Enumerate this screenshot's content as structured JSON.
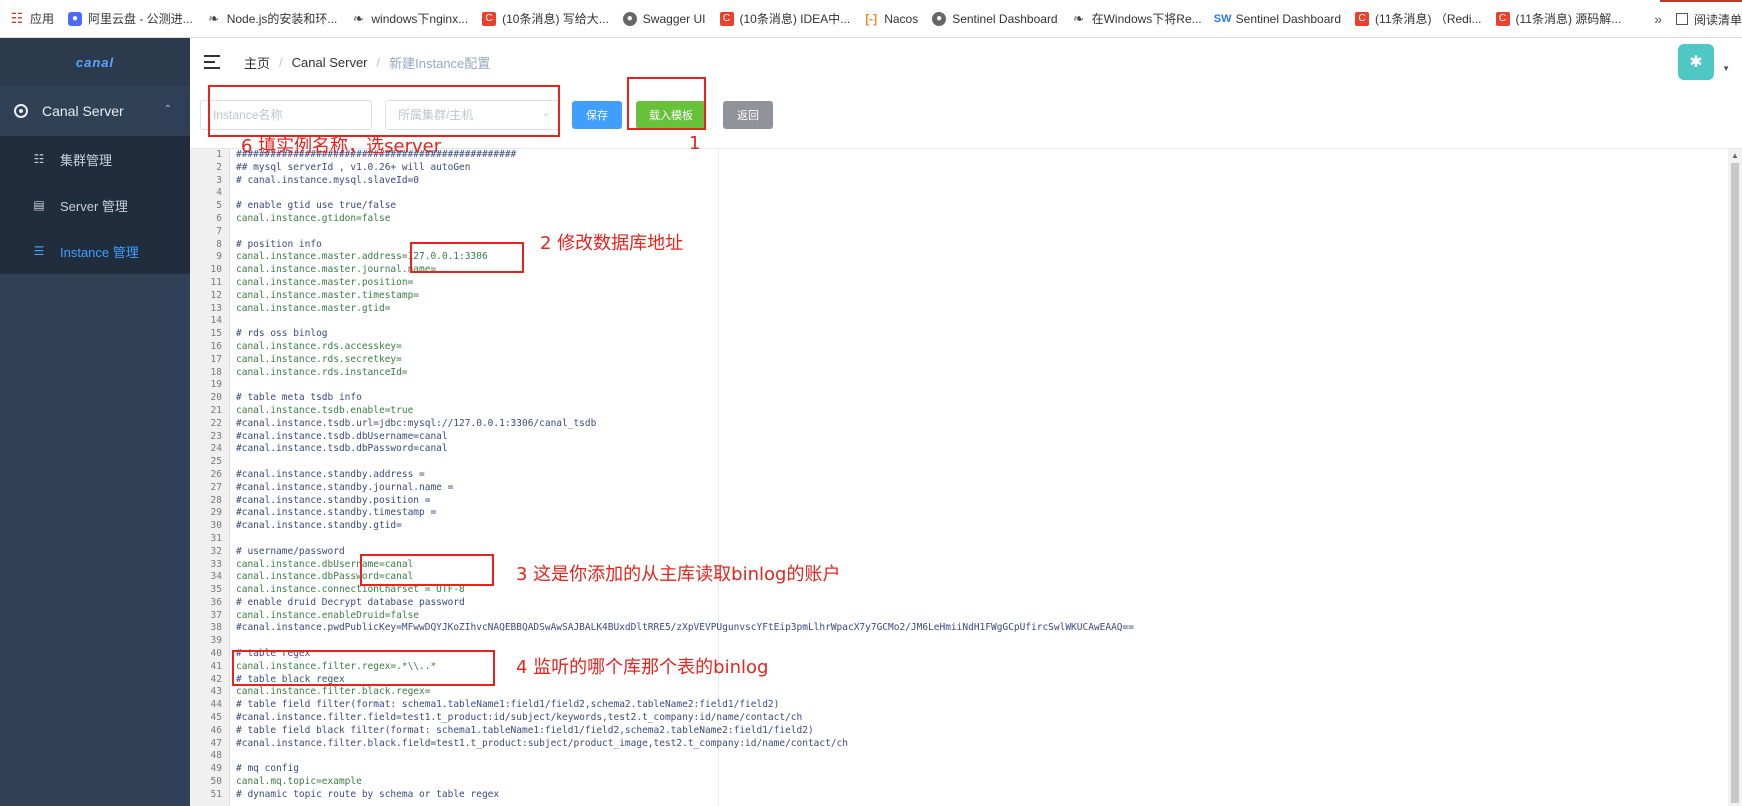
{
  "bookmarks": {
    "items": [
      {
        "icon": "apps-grid-icon",
        "label": "应用"
      },
      {
        "icon": "aliyun-icon",
        "label": "阿里云盘 - 公测进..."
      },
      {
        "icon": "yuque-icon",
        "label": "Node.js的安装和环..."
      },
      {
        "icon": "yuque-icon",
        "label": "windows下nginx..."
      },
      {
        "icon": "csdn-icon",
        "label": "(10条消息) 写给大..."
      },
      {
        "icon": "globe-icon",
        "label": "Swagger UI"
      },
      {
        "icon": "csdn-icon",
        "label": "(10条消息) IDEA中..."
      },
      {
        "icon": "nacos-icon",
        "label": "Nacos"
      },
      {
        "icon": "globe-icon",
        "label": "Sentinel Dashboard"
      },
      {
        "icon": "yuque-icon",
        "label": "在Windows下将Re..."
      },
      {
        "icon": "sw-icon",
        "label": "Sentinel Dashboard"
      },
      {
        "icon": "csdn-icon",
        "label": "(11条消息) （Redi..."
      },
      {
        "icon": "csdn-icon",
        "label": "(11条消息) 源码解..."
      }
    ],
    "more": "»",
    "reader": "阅读清单"
  },
  "sidebar": {
    "logo": "canal",
    "group_label": "Canal Server",
    "items": [
      {
        "label": "集群管理",
        "icon": "cluster-icon"
      },
      {
        "label": "Server 管理",
        "icon": "server-icon"
      },
      {
        "label": "Instance 管理",
        "icon": "list-icon"
      }
    ]
  },
  "breadcrumb": {
    "home": "主页",
    "section": "Canal Server",
    "current": "新建Instance配置",
    "sep": "/"
  },
  "form": {
    "name_placeholder": "Instance名称",
    "cluster_placeholder": "所属集群/主机",
    "save_label": "保存",
    "load_label": "载入模板",
    "back_label": "返回"
  },
  "editor": {
    "lines": [
      "#################################################",
      "## mysql serverId , v1.0.26+ will autoGen",
      "# canal.instance.mysql.slaveId=0",
      "",
      "# enable gtid use true/false",
      "canal.instance.gtidon=false",
      "",
      "# position info",
      "canal.instance.master.address=127.0.0.1:3306",
      "canal.instance.master.journal.name=",
      "canal.instance.master.position=",
      "canal.instance.master.timestamp=",
      "canal.instance.master.gtid=",
      "",
      "# rds oss binlog",
      "canal.instance.rds.accesskey=",
      "canal.instance.rds.secretkey=",
      "canal.instance.rds.instanceId=",
      "",
      "# table meta tsdb info",
      "canal.instance.tsdb.enable=true",
      "#canal.instance.tsdb.url=jdbc:mysql://127.0.0.1:3306/canal_tsdb",
      "#canal.instance.tsdb.dbUsername=canal",
      "#canal.instance.tsdb.dbPassword=canal",
      "",
      "#canal.instance.standby.address =",
      "#canal.instance.standby.journal.name =",
      "#canal.instance.standby.position =",
      "#canal.instance.standby.timestamp =",
      "#canal.instance.standby.gtid=",
      "",
      "# username/password",
      "canal.instance.dbUsername=canal",
      "canal.instance.dbPassword=canal",
      "canal.instance.connectionCharset = UTF-8",
      "# enable druid Decrypt database password",
      "canal.instance.enableDruid=false",
      "#canal.instance.pwdPublicKey=MFwwDQYJKoZIhvcNAQEBBQADSwAwSAJBALK4BUxdDltRRE5/zXpVEVPUgunvscYFtEip3pmLlhrWpacX7y7GCMo2/JM6LeHmiiNdH1FWgGCpUfircSwlWKUCAwEAAQ==",
      "",
      "# table regex",
      "canal.instance.filter.regex=.*\\\\..*",
      "# table black regex",
      "canal.instance.filter.black.regex=",
      "# table field filter(format: schema1.tableName1:field1/field2,schema2.tableName2:field1/field2)",
      "#canal.instance.filter.field=test1.t_product:id/subject/keywords,test2.t_company:id/name/contact/ch",
      "# table field black filter(format: schema1.tableName1:field1/field2,schema2.tableName2:field1/field2)",
      "#canal.instance.filter.black.field=test1.t_product:subject/product_image,test2.t_company:id/name/contact/ch",
      "",
      "# mq config",
      "canal.mq.topic=example",
      "# dynamic topic route by schema or table regex"
    ]
  },
  "annotations": {
    "a1": "1",
    "a2": "2 修改数据库地址",
    "a3": "3 这是你添加的从主库读取binlog的账户",
    "a4": "4 监听的哪个库那个表的binlog",
    "a6": "6 填实例名称，选server"
  },
  "colors": {
    "sidebar_bg": "#304156",
    "active_menu": "#409eff",
    "save_button": "#409eff",
    "load_button": "#67c23a",
    "back_button": "#909399",
    "annotation": "#e8231c"
  }
}
